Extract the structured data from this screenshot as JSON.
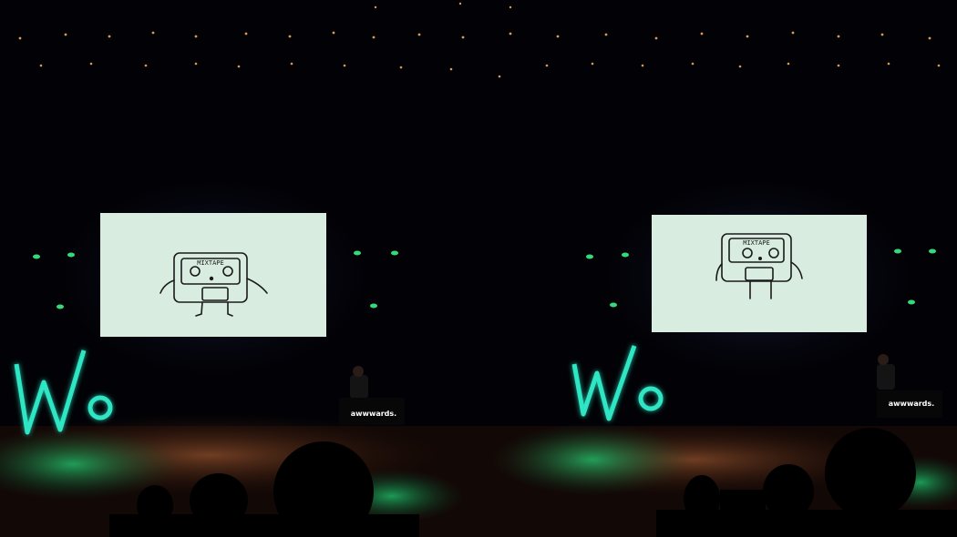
{
  "scene": {
    "panels": [
      {
        "id": "left",
        "screen_drawing_text": "MIXTAPE",
        "podium_text": "awwwards."
      },
      {
        "id": "right",
        "screen_drawing_text": "MIXTAPE",
        "podium_text": "awwwards."
      }
    ]
  },
  "colors": {
    "background": "#020206",
    "screen": "#d8ede0",
    "neon": "#2ee6c4",
    "green_light": "#35d97a",
    "stage_floor": "#6a3a22",
    "audience": "#000000"
  }
}
